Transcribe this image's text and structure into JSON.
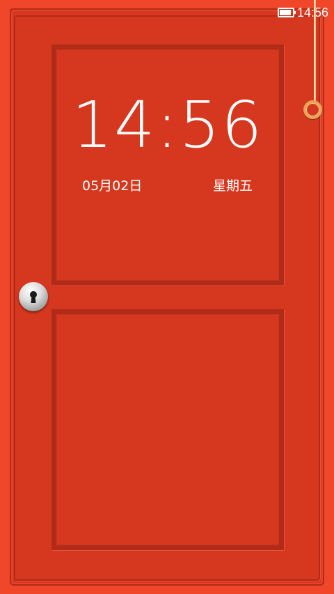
{
  "status_bar": {
    "time": "14:56",
    "battery_level": 0.9,
    "battery_icon": "battery-icon"
  },
  "lockscreen": {
    "clock": "14:56",
    "date": "05月02日",
    "weekday": "星期五"
  },
  "theme": {
    "door_color": "#d5381f",
    "frame_color": "#f0472a",
    "ring_color": "#e9a556"
  },
  "controls": {
    "pull_ring_icon": "ring-pull-icon",
    "keyhole_icon": "keyhole-lock-icon"
  }
}
